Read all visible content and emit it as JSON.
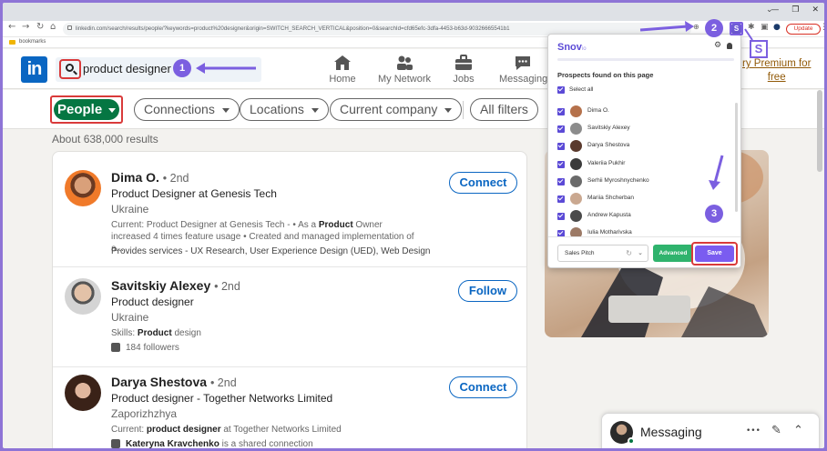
{
  "browser": {
    "url": "linkedin.com/search/results/people/?keywords=product%20designer&origin=SWITCH_SEARCH_VERTICAL&position=0&searchId=cfd65efc-3dfa-4453-b63d-90326665541b1",
    "bookmarks_label": "bookmarks",
    "update_label": "Update",
    "back_glyph": "←",
    "forward_glyph": "→",
    "reload_glyph": "↻",
    "home_glyph": "⌂",
    "minimize_glyph": "—",
    "maximize_glyph": "❐",
    "close_glyph": "✕",
    "tabs_glyph": "⌄",
    "zoom_glyph": "⊕",
    "share_glyph": "⇪",
    "puzzle_glyph": "✱",
    "sidebar_glyph": "▣",
    "profile_glyph": "●",
    "menu_glyph": "⋮",
    "extension_letter": "S",
    "extension_small": "s2.1.1"
  },
  "linkedin": {
    "logo": "in",
    "search_value": "product designer",
    "nav": [
      {
        "label": "Home",
        "icon": "home-icon"
      },
      {
        "label": "My Network",
        "icon": "network-icon"
      },
      {
        "label": "Jobs",
        "icon": "briefcase-icon"
      },
      {
        "label": "Messaging",
        "icon": "chat-icon"
      }
    ],
    "premium_line1": "ry Premium for",
    "premium_line2": "free",
    "filters": {
      "people": "People",
      "connections": "Connections",
      "locations": "Locations",
      "current_company": "Current company",
      "all_filters": "All filters"
    },
    "result_count": "About 638,000 results",
    "results": [
      {
        "name": "Dima O.",
        "degree": "• 2nd",
        "title": "Product Designer at Genesis Tech",
        "location": "Ukraine",
        "summary_pre": "Current: Product Designer at Genesis Tech - • As a ",
        "summary_bold": "Product",
        "summary_post": " Owner increased 4 times feature usage • Created and managed implementation of a...",
        "services": "Provides services - UX Research, User Experience Design (UED), Web Design",
        "action": "Connect"
      },
      {
        "name": "Savitskiy Alexey",
        "degree": "• 2nd",
        "title": "Product designer",
        "location": "Ukraine",
        "skills_pre": "Skills: ",
        "skills_bold": "Product",
        "skills_post": " design",
        "followers": "184 followers",
        "action": "Follow"
      },
      {
        "name": "Darya Shestova",
        "degree": "• 2nd",
        "title": "Product designer - Together Networks Limited",
        "location": "Zaporizhzhya",
        "summary_pre": "Current: ",
        "summary_bold": "product designer",
        "summary_post": " at Together Networks Limited",
        "shared_bold": "Kateryna Kravchenko",
        "shared_post": " is a shared connection",
        "action": "Connect"
      }
    ],
    "messaging": {
      "label": "Messaging",
      "dots_glyph": "•••",
      "compose_glyph": "✎",
      "collapse_glyph": "⌃"
    }
  },
  "snov": {
    "logo": "Snov",
    "logo_suffix": "io",
    "gear_glyph": "⚙",
    "user_glyph": "👤",
    "heading": "Prospects found on this page",
    "select_all": "Select all",
    "prospects": [
      {
        "name": "Dima O.",
        "color": "#b5714b"
      },
      {
        "name": "Savitskiy Alexey",
        "color": "#8c8c8c"
      },
      {
        "name": "Darya Shestova",
        "color": "#5a3a2d"
      },
      {
        "name": "Valeriia Pukhir",
        "color": "#3b3b3b"
      },
      {
        "name": "Serhii Myroshnychenko",
        "color": "#6a6a6a"
      },
      {
        "name": "Mariia Shcherban",
        "color": "#caa890"
      },
      {
        "name": "Andrew Kapusta",
        "color": "#4a4a4a"
      },
      {
        "name": "Iulia Motharivska",
        "color": "#9c7a66"
      }
    ],
    "list_select": "Sales Pitch",
    "advanced": "Advanced",
    "save": "Save"
  },
  "annotations": {
    "step1": "1",
    "step2": "2",
    "step3": "3",
    "s_label": "S"
  },
  "colors": {
    "linkedin_blue": "#0a66c2",
    "people_green": "#057642",
    "snov_purple": "#7a5cf0",
    "annotation_purple": "#7b5fe0",
    "highlight_red": "#d93a3a"
  }
}
